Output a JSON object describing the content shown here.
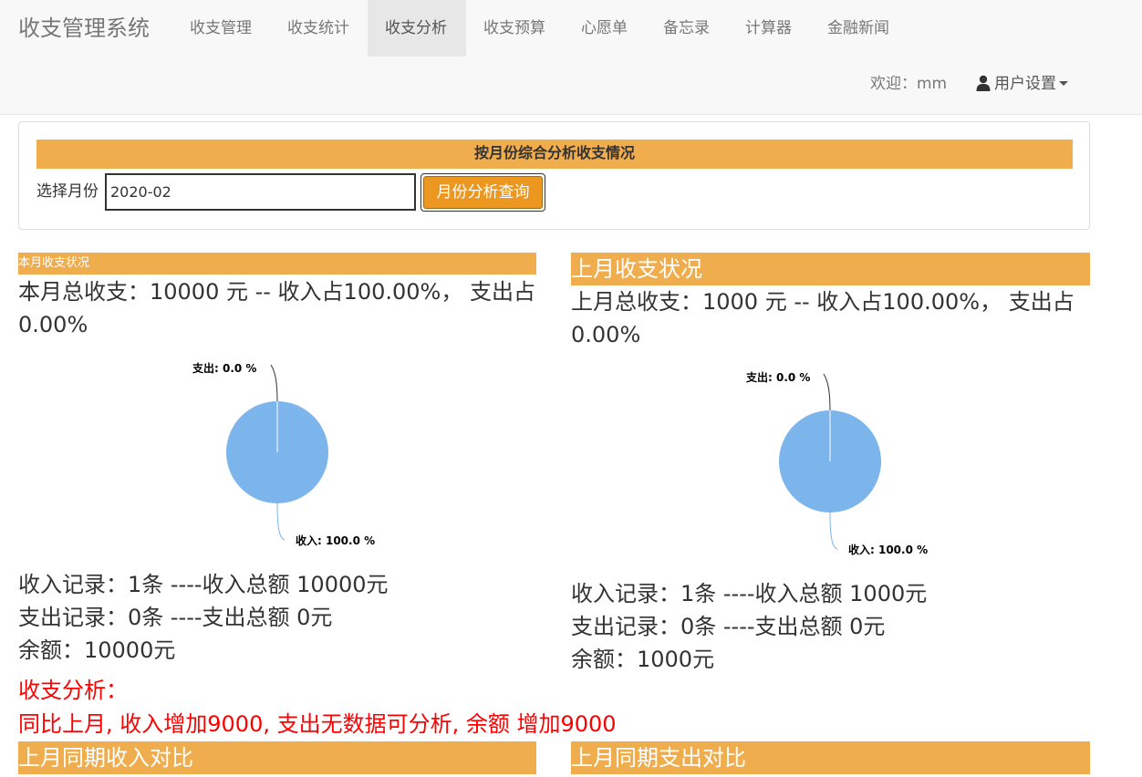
{
  "navbar": {
    "brand": "收支管理系统",
    "items": [
      {
        "label": "收支管理",
        "active": false
      },
      {
        "label": "收支统计",
        "active": false
      },
      {
        "label": "收支分析",
        "active": true
      },
      {
        "label": "收支预算",
        "active": false
      },
      {
        "label": "心愿单",
        "active": false
      },
      {
        "label": "备忘录",
        "active": false
      },
      {
        "label": "计算器",
        "active": false
      },
      {
        "label": "金融新闻",
        "active": false
      }
    ],
    "welcome": "欢迎：mm",
    "user_settings": "用户设置"
  },
  "query": {
    "title": "按月份综合分析收支情况",
    "month_label": "选择月份",
    "month_value": "2020-02",
    "button": "月份分析查询"
  },
  "current_month": {
    "header": "本月收支状况",
    "summary": "本月总收支：10000 元 -- 收入占100.00%， 支出占0.00%",
    "pie": {
      "expense_label": "支出: 0.0 %",
      "income_label": "收入: 100.0 %",
      "income_percent": 100.0,
      "expense_percent": 0.0
    },
    "income_record": "收入记录：1条 ----收入总额 10000元",
    "expense_record": "支出记录：0条 ----支出总额 0元",
    "balance": "余额：10000元"
  },
  "last_month": {
    "header": "上月收支状况",
    "summary": "上月总收支：1000 元 -- 收入占100.00%， 支出占0.00%",
    "pie": {
      "expense_label": "支出: 0.0 %",
      "income_label": "收入: 100.0 %",
      "income_percent": 100.0,
      "expense_percent": 0.0
    },
    "income_record": "收入记录：1条 ----收入总额 1000元",
    "expense_record": "支出记录：0条 ----支出总额 0元",
    "balance": "余额：1000元"
  },
  "analysis": {
    "title": "收支分析：",
    "text": "同比上月, 收入增加9000, 支出无数据可分析, 余额 增加9000"
  },
  "comparison": {
    "income_header": "上月同期收入对比",
    "expense_header": "上月同期支出对比"
  },
  "colors": {
    "accent": "#f0ad4e",
    "pie_income": "#7cb5ec",
    "alert": "#ff0000"
  }
}
